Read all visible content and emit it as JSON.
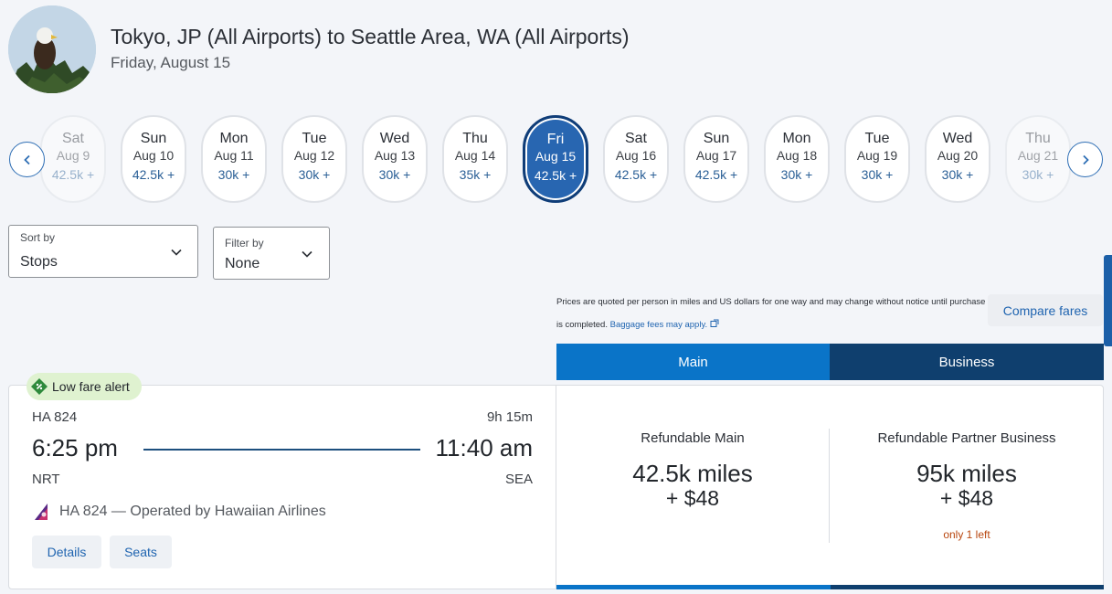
{
  "header": {
    "title": "Tokyo, JP (All Airports) to Seattle Area, WA (All Airports)",
    "subtitle": "Friday, August 15"
  },
  "dates": [
    {
      "day": "Sat",
      "date": "Aug 9",
      "price": "42.5k +"
    },
    {
      "day": "Sun",
      "date": "Aug 10",
      "price": "42.5k +"
    },
    {
      "day": "Mon",
      "date": "Aug 11",
      "price": "30k +"
    },
    {
      "day": "Tue",
      "date": "Aug 12",
      "price": "30k +"
    },
    {
      "day": "Wed",
      "date": "Aug 13",
      "price": "30k +"
    },
    {
      "day": "Thu",
      "date": "Aug 14",
      "price": "35k +"
    },
    {
      "day": "Fri",
      "date": "Aug 15",
      "price": "42.5k +"
    },
    {
      "day": "Sat",
      "date": "Aug 16",
      "price": "42.5k +"
    },
    {
      "day": "Sun",
      "date": "Aug 17",
      "price": "42.5k +"
    },
    {
      "day": "Mon",
      "date": "Aug 18",
      "price": "30k +"
    },
    {
      "day": "Tue",
      "date": "Aug 19",
      "price": "30k +"
    },
    {
      "day": "Wed",
      "date": "Aug 20",
      "price": "30k +"
    },
    {
      "day": "Thu",
      "date": "Aug 21",
      "price": "30k +"
    }
  ],
  "sort": {
    "label": "Sort by",
    "value": "Stops"
  },
  "filter": {
    "label": "Filter by",
    "value": "None"
  },
  "notice": {
    "text": "Prices are quoted per person in miles and US dollars for one way and may change without notice until purchase is completed.",
    "link": "Baggage fees may apply."
  },
  "compare_label": "Compare fares",
  "tabs": {
    "main": "Main",
    "business": "Business"
  },
  "flight": {
    "badge": "Low fare alert",
    "number": "HA 824",
    "duration": "9h 15m",
    "depart_time": "6:25 pm",
    "arrive_time": "11:40 am",
    "depart_code": "NRT",
    "arrive_code": "SEA",
    "operated": "HA 824 — Operated by Hawaiian Airlines",
    "details_label": "Details",
    "seats_label": "Seats"
  },
  "fares": {
    "main": {
      "name": "Refundable Main",
      "miles": "42.5k miles",
      "cash": "+ $48"
    },
    "business": {
      "name": "Refundable Partner Business",
      "miles": "95k miles",
      "cash": "+ $48",
      "note": "only 1 left"
    }
  },
  "colors": {
    "accent": "#2866b1",
    "main_tab": "#0a74c8",
    "business_tab": "#0f3f6e",
    "alert_bg": "#dff2d0",
    "warning": "#b8460f"
  },
  "icons": [
    "profile-avatar",
    "chevron-left-icon",
    "chevron-right-icon",
    "chevron-down-icon",
    "external-link-icon",
    "tag-icon",
    "hawaiian-airlines-logo"
  ]
}
